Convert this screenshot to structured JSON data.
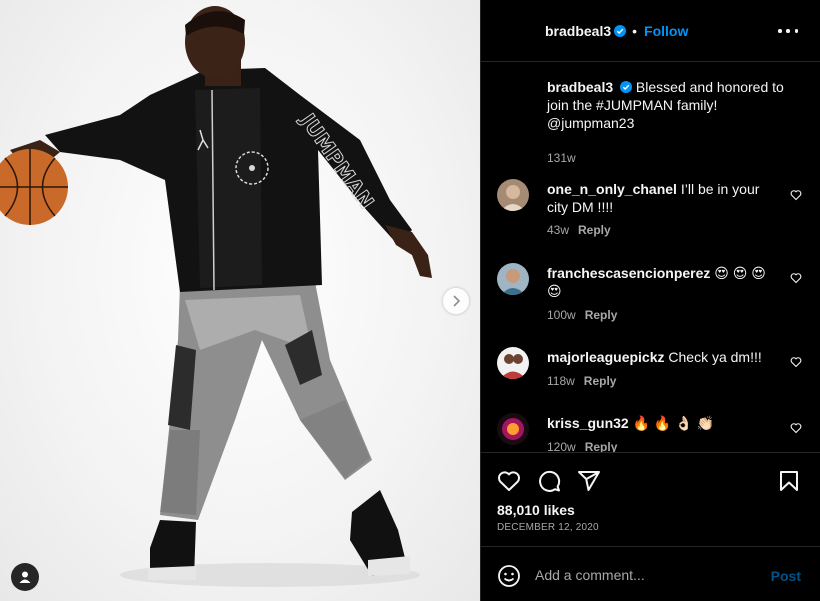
{
  "post": {
    "username": "bradbeal3",
    "follow_label": "Follow",
    "separator": "•",
    "caption": "Blessed and honored to join the #JUMPMAN family! @jumpman23",
    "caption_time": "131w",
    "likes": "88,010 likes",
    "date": "DECEMBER 12, 2020"
  },
  "comments": [
    {
      "username": "one_n_only_chanel",
      "text": "I’ll be in your city DM !!!!",
      "time": "43w",
      "reply": "Reply"
    },
    {
      "username": "franchescasencionperez",
      "text": "😍 😍 😍 😍",
      "time": "100w",
      "reply": "Reply"
    },
    {
      "username": "majorleaguepickz",
      "text": "Check ya dm!!!",
      "time": "118w",
      "reply": "Reply"
    },
    {
      "username": "kriss_gun32",
      "text": "🔥 🔥 👌🏻 👏🏻",
      "time": "120w",
      "reply": "Reply"
    }
  ],
  "composer": {
    "placeholder": "Add a comment...",
    "post_label": "Post"
  },
  "colors": {
    "accent": "#0095f6",
    "background": "#000000",
    "divider": "#262626",
    "muted": "#a8a8a8"
  },
  "icons": [
    "verified-icon",
    "more-options-icon",
    "heart-icon",
    "comment-icon",
    "share-icon",
    "save-icon",
    "emoji-icon",
    "next-arrow-icon",
    "user-tag-icon"
  ]
}
